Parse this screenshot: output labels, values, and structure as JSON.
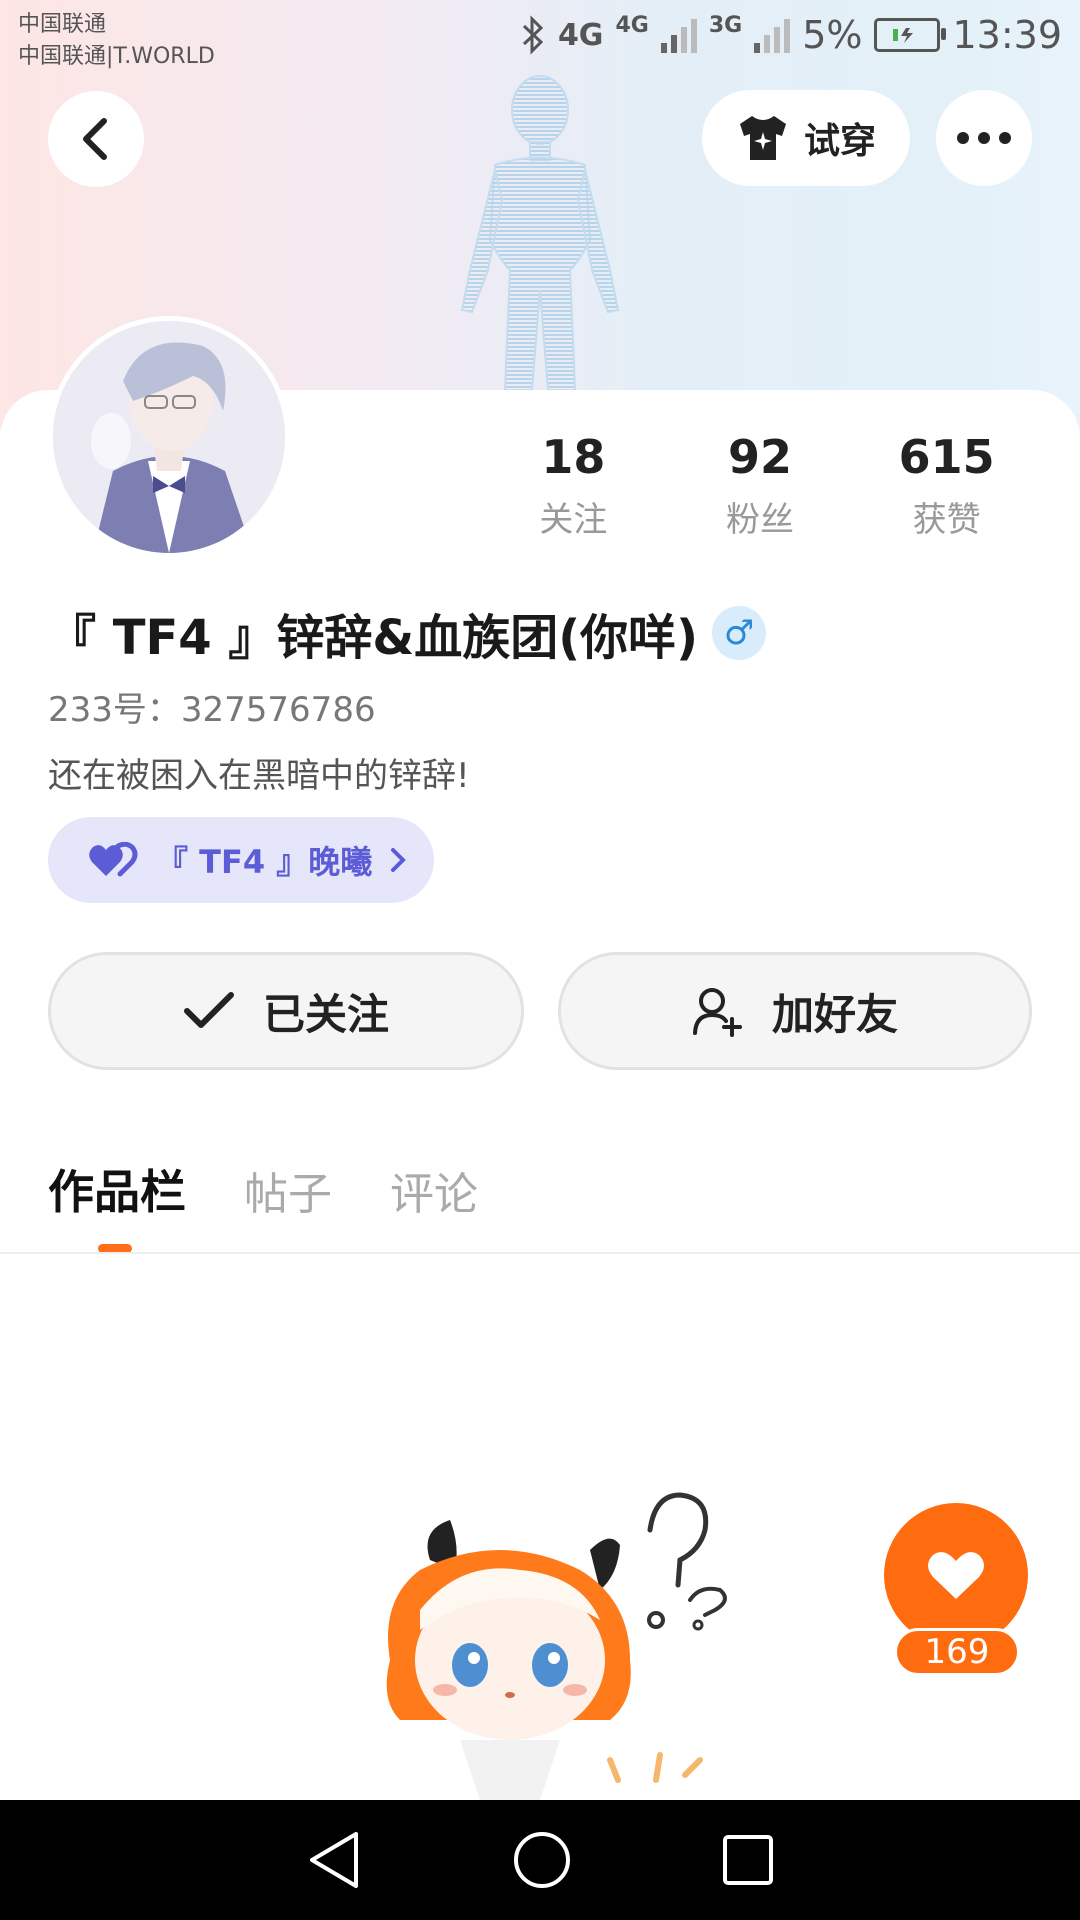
{
  "status_bar": {
    "carrier_primary": "中国联通",
    "carrier_secondary": "中国联通|T.WORLD",
    "network_1": "4G",
    "network_2": "4G",
    "network_3": "3G",
    "battery_percent": "5%",
    "time": "13:39"
  },
  "header": {
    "tryon_label": "试穿"
  },
  "profile": {
    "username": "『 TF4 』锌辞&血族团(你咩)",
    "gender_symbol": "♂",
    "uid": "233号：327576786",
    "bio": "还在被困入在黑暗中的锌辞!",
    "guild_label": "『 TF4 』晚曦"
  },
  "stats": [
    {
      "value": "18",
      "label": "关注"
    },
    {
      "value": "92",
      "label": "粉丝"
    },
    {
      "value": "615",
      "label": "获赞"
    }
  ],
  "actions": {
    "followed_label": "已关注",
    "add_friend_label": "加好友"
  },
  "tabs": [
    {
      "label": "作品栏",
      "active": true
    },
    {
      "label": "帖子",
      "active": false
    },
    {
      "label": "评论",
      "active": false
    }
  ],
  "like_fab": {
    "count": "169"
  },
  "colors": {
    "accent": "#ff6c10",
    "guild_bg": "#e6e6fb",
    "guild_text": "#5c5cd6"
  }
}
